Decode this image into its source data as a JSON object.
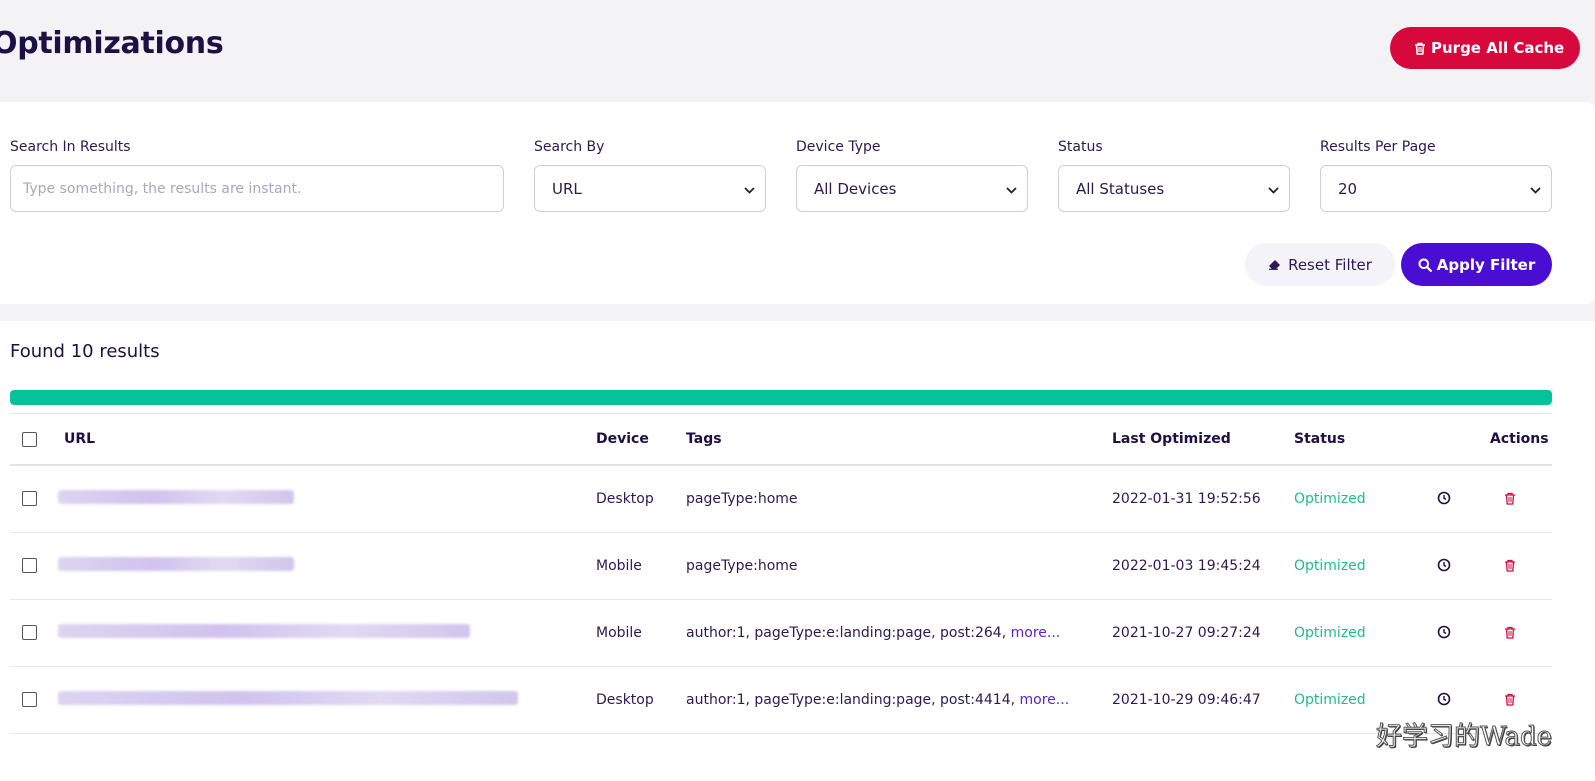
{
  "page": {
    "title": "Optimizations",
    "purge_label": "Purge All Cache"
  },
  "filters": {
    "search_label": "Search In Results",
    "search_placeholder": "Type something, the results are instant.",
    "search_by_label": "Search By",
    "search_by_value": "URL",
    "device_label": "Device Type",
    "device_value": "All Devices",
    "status_label": "Status",
    "status_value": "All Statuses",
    "per_page_label": "Results Per Page",
    "per_page_value": "20",
    "reset_label": "Reset Filter",
    "apply_label": "Apply Filter"
  },
  "results": {
    "count_text": "Found 10 results",
    "progress_percent": 100,
    "columns": {
      "url": "URL",
      "device": "Device",
      "tags": "Tags",
      "last_optimized": "Last Optimized",
      "status": "Status",
      "actions": "Actions"
    },
    "rows": [
      {
        "device": "Desktop",
        "tags": "pageType:home",
        "more": "",
        "last_optimized": "2022-01-31 19:52:56",
        "status": "Optimized"
      },
      {
        "device": "Mobile",
        "tags": "pageType:home",
        "more": "",
        "last_optimized": "2022-01-03 19:45:24",
        "status": "Optimized"
      },
      {
        "device": "Mobile",
        "tags": "author:1, pageType:e:landing:page, post:264, ",
        "more": "more...",
        "last_optimized": "2021-10-27 09:27:24",
        "status": "Optimized"
      },
      {
        "device": "Desktop",
        "tags": "author:1, pageType:e:landing:page, post:4414, ",
        "more": "more...",
        "last_optimized": "2021-10-29 09:46:47",
        "status": "Optimized"
      }
    ]
  },
  "watermark": "好学习的Wade",
  "colors": {
    "purge": "#d7083b",
    "apply": "#4a0ed3",
    "progress": "#05c29b",
    "optimized": "#1fbd86",
    "delete": "#d7083b"
  }
}
